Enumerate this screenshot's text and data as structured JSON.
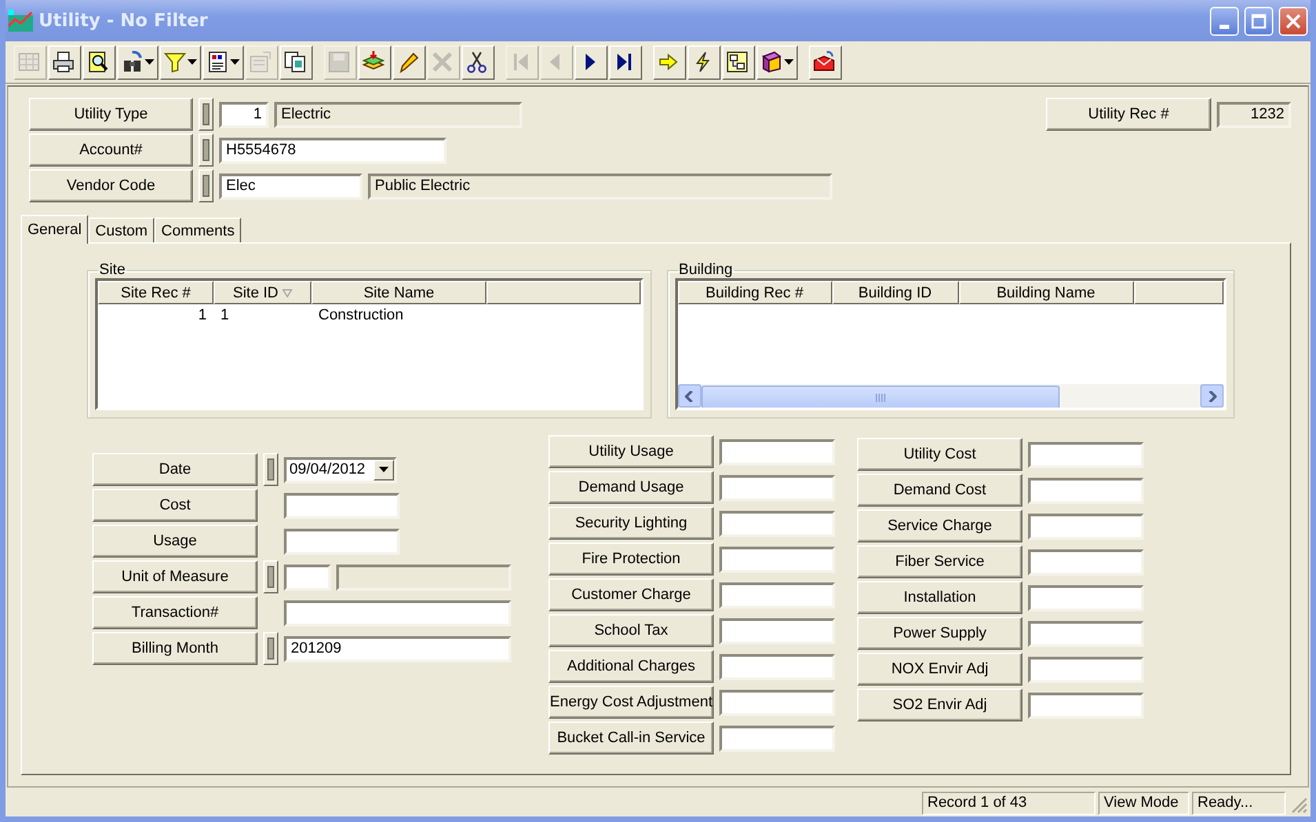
{
  "window": {
    "title": "Utility - No Filter"
  },
  "toolbar": [
    [
      {
        "disabled": true,
        "dropdown": false
      },
      {
        "disabled": false,
        "dropdown": false
      },
      {
        "disabled": false,
        "dropdown": false
      },
      {
        "disabled": false,
        "dropdown": true
      },
      {
        "disabled": false,
        "dropdown": true
      },
      {
        "disabled": false,
        "dropdown": true
      },
      {
        "disabled": true,
        "dropdown": false
      },
      {
        "disabled": false,
        "dropdown": false
      }
    ],
    [
      {
        "disabled": true,
        "dropdown": false
      },
      {
        "disabled": false,
        "dropdown": false
      },
      {
        "disabled": false,
        "dropdown": false
      },
      {
        "disabled": true,
        "dropdown": false
      },
      {
        "disabled": false,
        "dropdown": false
      }
    ],
    [
      {
        "disabled": true,
        "dropdown": false
      },
      {
        "disabled": true,
        "dropdown": false
      },
      {
        "disabled": false,
        "dropdown": false
      },
      {
        "disabled": false,
        "dropdown": false
      }
    ],
    [
      {
        "disabled": false,
        "dropdown": false
      },
      {
        "disabled": false,
        "dropdown": false
      },
      {
        "disabled": false,
        "dropdown": false
      },
      {
        "disabled": false,
        "dropdown": true
      }
    ],
    [
      {
        "disabled": false,
        "dropdown": false
      }
    ]
  ],
  "header": {
    "rows": [
      {
        "label": "Utility Type",
        "lookup": true,
        "fields": [
          {
            "kind": "code",
            "value": "1"
          },
          {
            "kind": "readonly",
            "value": "Electric"
          }
        ]
      },
      {
        "label": "Account#",
        "lookup": true,
        "fields": [
          {
            "kind": "input",
            "value": "H5554678"
          }
        ]
      },
      {
        "label": "Vendor Code",
        "lookup": true,
        "fields": [
          {
            "kind": "medium",
            "value": "Elec"
          },
          {
            "kind": "readonly-long",
            "value": "Public Electric"
          }
        ]
      }
    ],
    "record": {
      "label": "Utility Rec #",
      "value": "1232"
    }
  },
  "tabs": [
    {
      "label": "General",
      "selected": true
    },
    {
      "label": "Custom",
      "selected": false
    },
    {
      "label": "Comments",
      "selected": false
    }
  ],
  "site": {
    "title": "Site",
    "columns": [
      {
        "label": "Site Rec #",
        "sorted": false
      },
      {
        "label": "Site ID",
        "sorted": true
      },
      {
        "label": "Site Name",
        "sorted": false
      }
    ],
    "rows": [
      [
        "1",
        "1",
        "Construction"
      ]
    ]
  },
  "building": {
    "title": "Building",
    "columns": [
      {
        "label": "Building Rec #",
        "sorted": false
      },
      {
        "label": "Building ID",
        "sorted": false
      },
      {
        "label": "Building Name",
        "sorted": false
      }
    ]
  },
  "details": [
    {
      "label": "Date",
      "lookup": true,
      "fields": [
        {
          "kind": "date",
          "value": "09/04/2012"
        }
      ]
    },
    {
      "label": "Cost",
      "lookup": false,
      "fields": [
        {
          "kind": "amount"
        }
      ]
    },
    {
      "label": "Usage",
      "lookup": false,
      "fields": [
        {
          "kind": "amount"
        }
      ]
    },
    {
      "label": "Unit of Measure",
      "lookup": true,
      "fields": [
        {
          "kind": "small"
        },
        {
          "kind": "readonly"
        }
      ]
    },
    {
      "label": "Transaction#",
      "lookup": false,
      "fields": [
        {
          "kind": "wide"
        }
      ]
    },
    {
      "label": "Billing Month",
      "lookup": true,
      "fields": [
        {
          "kind": "wide",
          "value": "201209"
        }
      ]
    }
  ],
  "charges": [
    {
      "label": "Utility Usage"
    },
    {
      "label": "Demand Usage"
    },
    {
      "label": "Security Lighting"
    },
    {
      "label": "Fire Protection"
    },
    {
      "label": "Customer Charge"
    },
    {
      "label": "School Tax"
    },
    {
      "label": "Additional Charges"
    },
    {
      "label": "Energy Cost Adjustment"
    },
    {
      "label": "Bucket Call-in Service"
    }
  ],
  "costs": [
    {
      "label": "Utility Cost"
    },
    {
      "label": "Demand Cost"
    },
    {
      "label": "Service Charge"
    },
    {
      "label": "Fiber Service"
    },
    {
      "label": "Installation"
    },
    {
      "label": "Power Supply"
    },
    {
      "label": "NOX Envir Adj"
    },
    {
      "label": "SO2 Envir Adj"
    }
  ],
  "status_bar": [
    "Record 1 of 43",
    "View Mode",
    "Ready..."
  ]
}
